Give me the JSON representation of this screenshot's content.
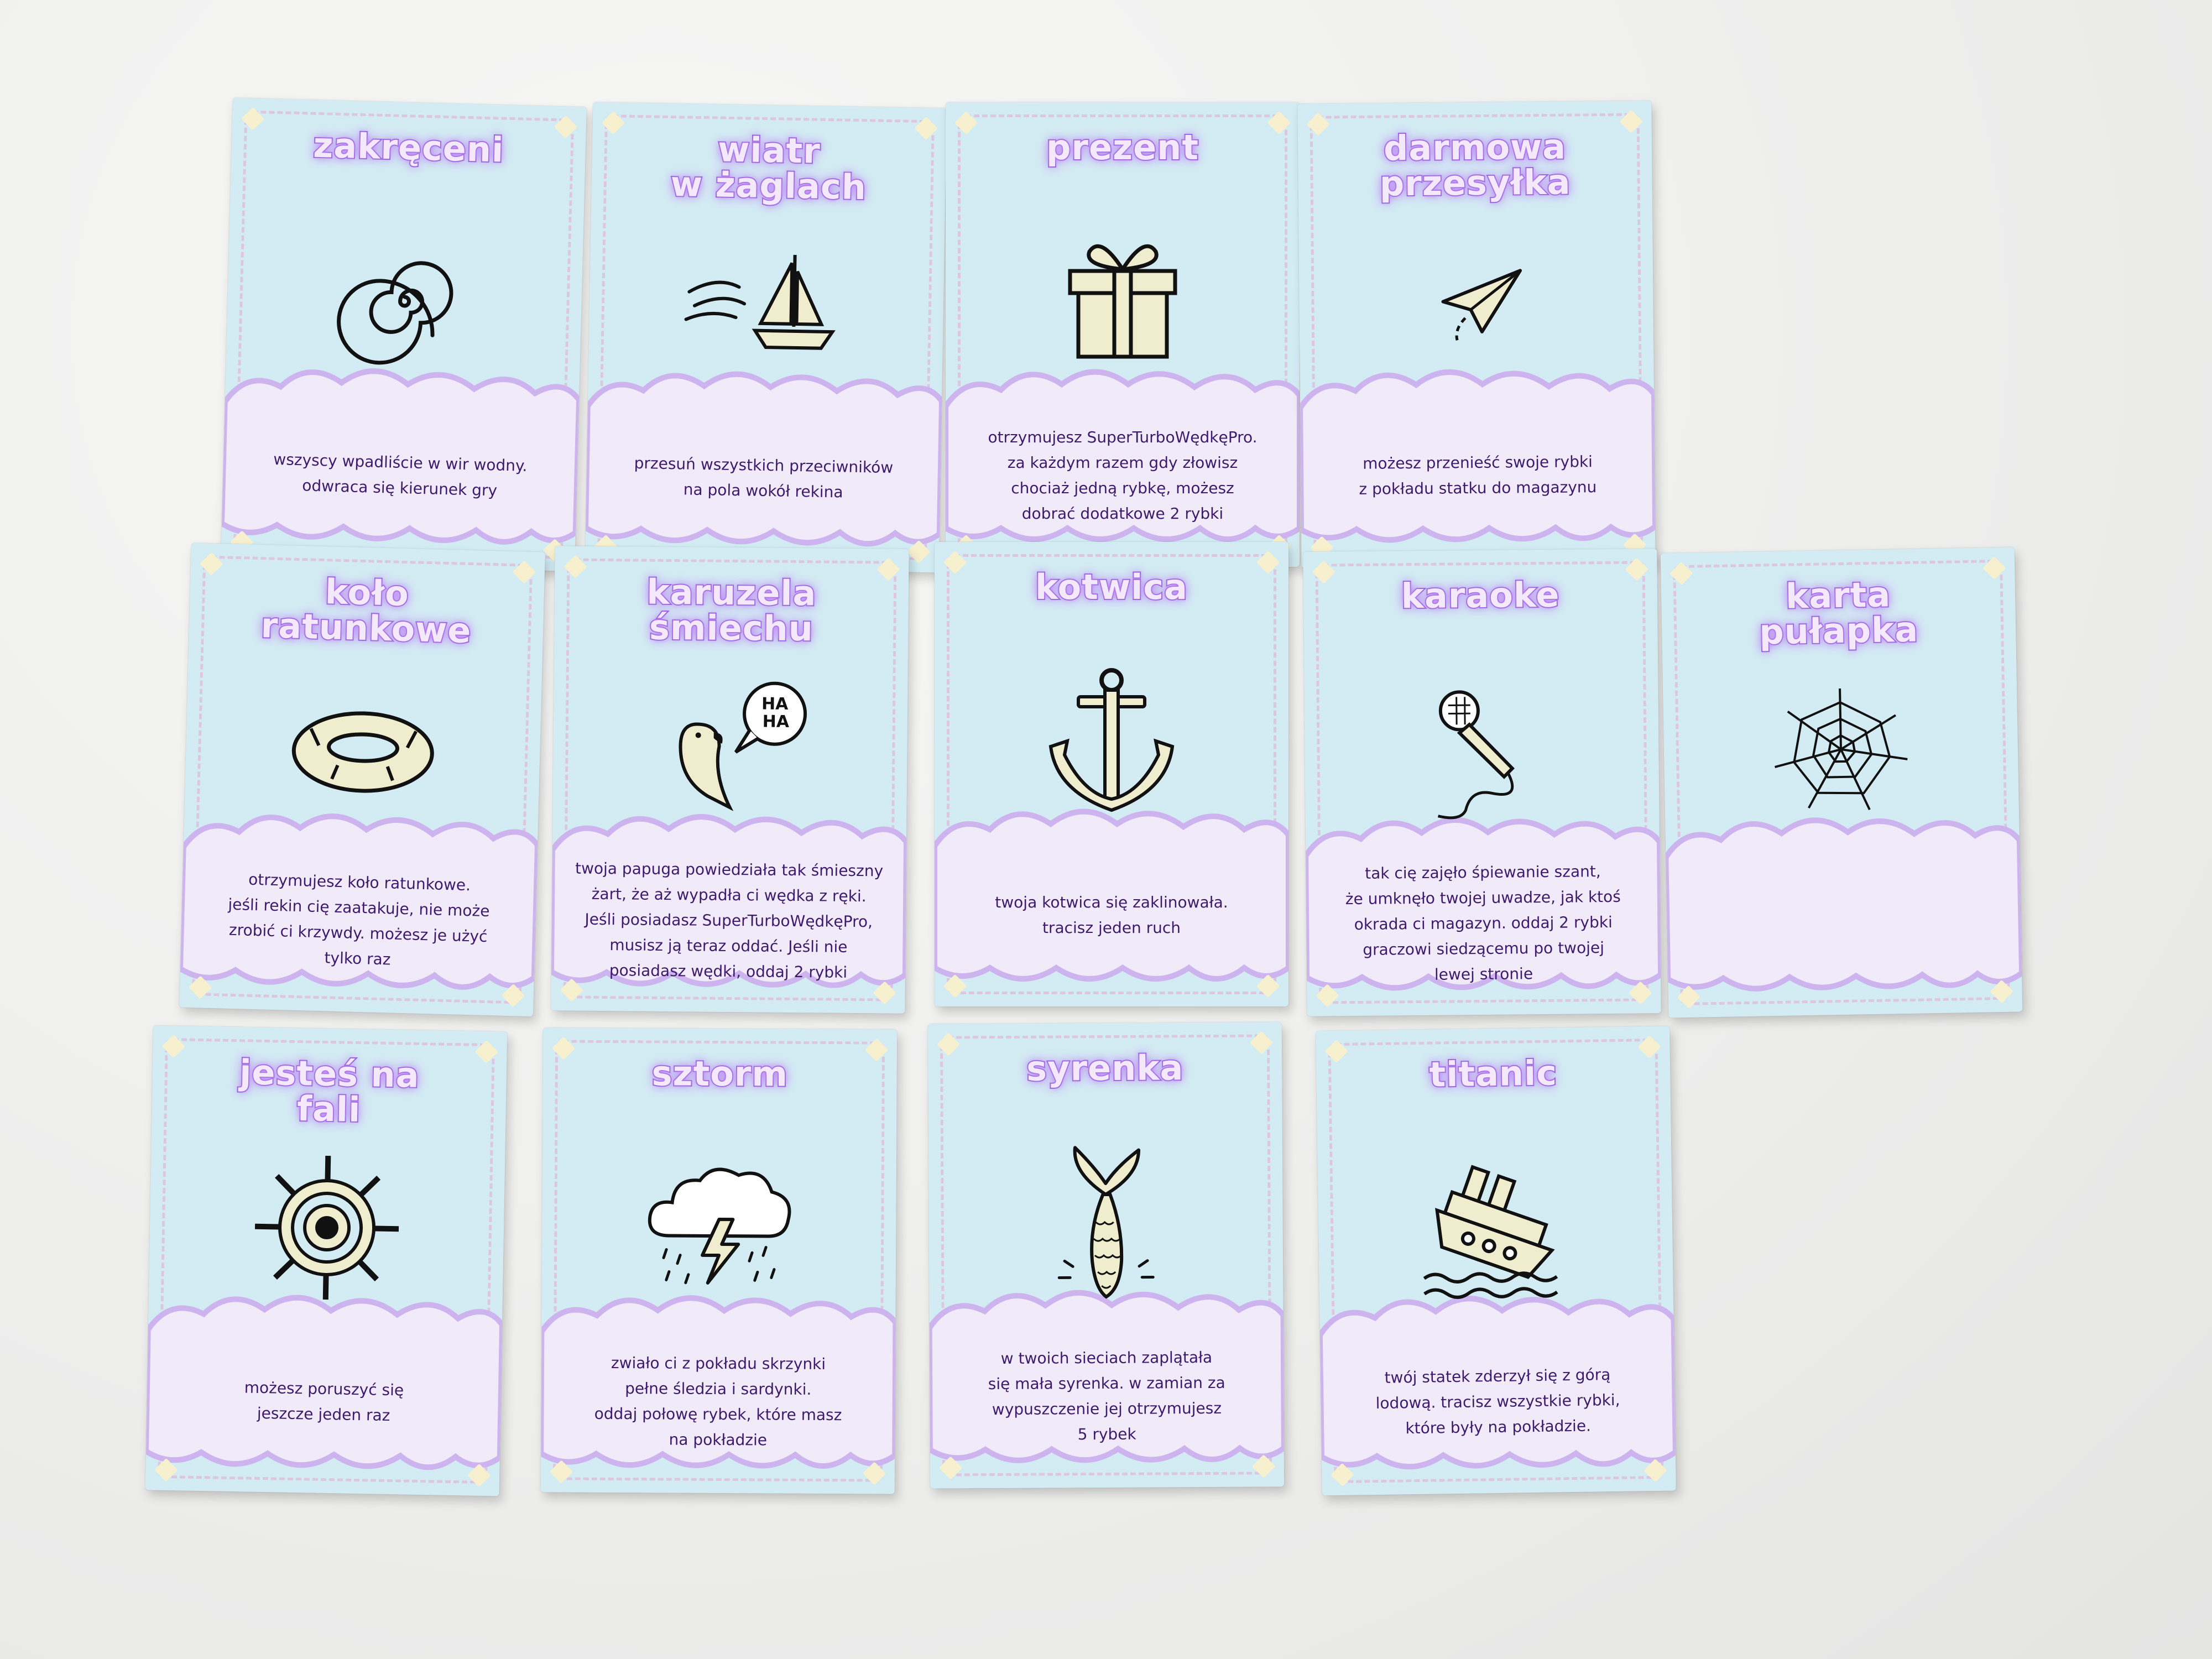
{
  "cards": [
    {
      "id": "zakreceni",
      "title": "zakręceni",
      "icon": "spiral-icon",
      "desc": "wszyscy wpadliście w wir wodny.\nodwraca się kierunek gry"
    },
    {
      "id": "wiatr",
      "title": "wiatr\nw żaglach",
      "icon": "sailboat-wind-icon",
      "desc": "przesuń wszystkich przeciwników\nna pola wokół rekina"
    },
    {
      "id": "prezent",
      "title": "prezent",
      "icon": "gift-icon",
      "desc": "otrzymujesz SuperTurboWędkęPro.\nza każdym razem gdy złowisz\nchociaż jedną rybkę, możesz\ndobrać dodatkowe 2 rybki"
    },
    {
      "id": "przesylka",
      "title": "darmowa\nprzesyłka",
      "icon": "paper-plane-icon",
      "desc": "możesz przenieść swoje rybki\nz pokładu statku do magazynu"
    },
    {
      "id": "kolo",
      "title": "koło\nratunkowe",
      "icon": "lifebuoy-icon",
      "desc": "otrzymujesz koło ratunkowe.\njeśli rekin cię zaatakuje, nie może\nzrobić ci krzywdy. możesz je użyć\ntylko raz"
    },
    {
      "id": "karuzela",
      "title": "karuzela\nśmiechu",
      "icon": "parrot-laughing-icon",
      "desc": "twoja papuga powiedziała tak śmieszny\nżart, że aż wypadła ci wędka z ręki.\nJeśli posiadasz SuperTurboWędkęPro,\nmusisz ją teraz oddać. Jeśli nie\nposiadasz wędki, oddaj 2 rybki"
    },
    {
      "id": "kotwica",
      "title": "kotwica",
      "icon": "anchor-icon",
      "desc": "twoja kotwica się zaklinowała.\ntracisz jeden ruch"
    },
    {
      "id": "karaoke",
      "title": "karaoke",
      "icon": "microphone-icon",
      "desc": "tak cię zajęło śpiewanie szant,\nże umknęło twojej uwadze, jak ktoś\nokrada ci magazyn. oddaj 2 rybki\ngraczowi siedzącemu po twojej\nlewej stronie"
    },
    {
      "id": "pulapka",
      "title": "karta\npułapka",
      "icon": "spiderweb-icon",
      "desc": ""
    },
    {
      "id": "fala",
      "title": "jesteś na\nfali",
      "icon": "ship-wheel-icon",
      "desc": "możesz poruszyć się\njeszcze jeden raz"
    },
    {
      "id": "sztorm",
      "title": "sztorm",
      "icon": "storm-cloud-icon",
      "desc": "zwiało ci z pokładu skrzynki\npełne śledzia i sardynki.\noddaj połowę rybek, które masz\nna pokładzie"
    },
    {
      "id": "syrenka",
      "title": "syrenka",
      "icon": "mermaid-tail-icon",
      "desc": "w twoich sieciach zaplątała\nsię mała syrenka. w zamian za\nwypuszczenie jej otrzymujesz\n5 rybek"
    },
    {
      "id": "titanic",
      "title": "titanic",
      "icon": "sinking-ship-icon",
      "desc": "twój statek zderzył się z górą\nlodową. tracisz wszystkie rybki,\nktóre były na pokładzie."
    }
  ]
}
